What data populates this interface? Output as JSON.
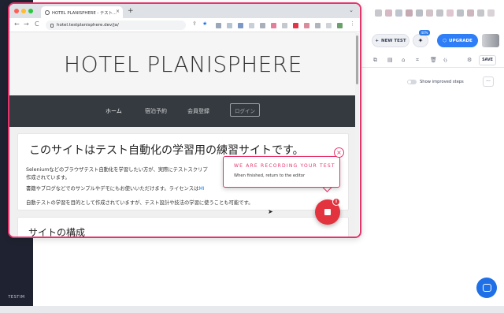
{
  "browser": {
    "tab_title": "HOTEL PLANISPHERE - テスト...",
    "tab_close": "×",
    "new_tab": "+",
    "tab_menu": "⌄",
    "url": "hotel.testplanisphere.dev/ja/",
    "back": "←",
    "forward": "→",
    "reload": "C"
  },
  "site": {
    "title": "HOTEL PLANISPHERE",
    "nav": {
      "home": "ホーム",
      "reserve": "宿泊予約",
      "signup": "会員登録",
      "login": "ログイン"
    },
    "card1": {
      "title": "このサイトはテスト自動化の学習用の練習サイトです。",
      "line1": "Seleniumなどのブラウザテスト自動化を学習したい方が、実際にテストスクリプ",
      "line2": "作成されています。",
      "line3_pre": "書籍やブログなどでのサンプルやデモにもお使いいただけます。ライセンスは",
      "line3_link": "MI",
      "line4": "自動テストの学習を目的として作成されていますが、テスト設計や技法の学習に使うことも可能です。"
    },
    "card2": {
      "title": "サイトの構成"
    }
  },
  "recorder": {
    "popup_title": "WE ARE RECORDING YOUR TEST",
    "popup_sub": "When finished, return to the editor",
    "close": "×"
  },
  "editor": {
    "new_test": "NEW TEST",
    "upgrade": "UPGRADE",
    "save": "SAVE",
    "improved_steps": "Show improved steps",
    "more": "···",
    "sidebar_label": "TESTIM",
    "badge": "40%",
    "new_test_icon": "+"
  },
  "colors": {
    "accent": "#e4346a",
    "stop": "#e2333f",
    "upgrade": "#2d7ef7",
    "nav_bg": "#343a40"
  }
}
